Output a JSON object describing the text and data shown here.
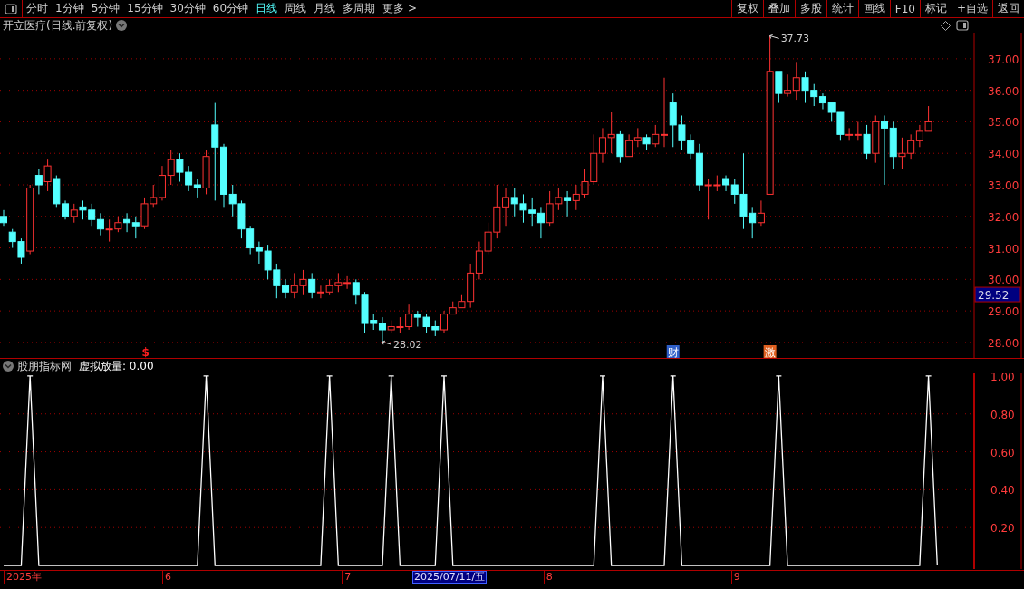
{
  "toolbar": {
    "tabs": [
      {
        "label": "分时",
        "selected": false
      },
      {
        "label": "1分钟",
        "selected": false
      },
      {
        "label": "5分钟",
        "selected": false
      },
      {
        "label": "15分钟",
        "selected": false
      },
      {
        "label": "30分钟",
        "selected": false
      },
      {
        "label": "60分钟",
        "selected": false
      },
      {
        "label": "日线",
        "selected": true
      },
      {
        "label": "周线",
        "selected": false
      },
      {
        "label": "月线",
        "selected": false
      },
      {
        "label": "多周期",
        "selected": false
      },
      {
        "label": "更多 >",
        "selected": false
      }
    ],
    "buttons": [
      "复权",
      "叠加",
      "多股",
      "统计",
      "画线",
      "F10",
      "标记",
      "+自选",
      "返回"
    ]
  },
  "main": {
    "title": "开立医疗(日线.前复权)",
    "chart_data": {
      "type": "candlestick",
      "grid": true,
      "ylim": [
        27.48,
        37.83
      ],
      "yticks": [
        {
          "value": 37,
          "label": "37.00"
        },
        {
          "value": 36,
          "label": "36.00"
        },
        {
          "value": 35,
          "label": "35.00"
        },
        {
          "value": 34,
          "label": "34.00"
        },
        {
          "value": 33,
          "label": "33.00"
        },
        {
          "value": 32,
          "label": "32.00"
        },
        {
          "value": 31,
          "label": "31.00"
        },
        {
          "value": 30,
          "label": "30.00"
        },
        {
          "value": 29,
          "label": "29.00"
        },
        {
          "value": 28,
          "label": "28.00"
        }
      ],
      "ohlc": [
        [
          32.0,
          32.2,
          31.7,
          31.8
        ],
        [
          31.5,
          31.6,
          31.0,
          31.2
        ],
        [
          31.2,
          31.3,
          30.5,
          30.7
        ],
        [
          30.9,
          33.0,
          30.8,
          32.9
        ],
        [
          33.3,
          33.5,
          32.7,
          33.0
        ],
        [
          33.1,
          33.8,
          32.8,
          33.6
        ],
        [
          33.2,
          33.3,
          32.3,
          32.4
        ],
        [
          32.4,
          32.5,
          31.9,
          32.0
        ],
        [
          32.0,
          32.4,
          31.8,
          32.2
        ],
        [
          32.3,
          32.5,
          31.9,
          32.2
        ],
        [
          32.2,
          32.4,
          31.7,
          31.9
        ],
        [
          31.9,
          32.1,
          31.4,
          31.6
        ],
        [
          31.6,
          31.9,
          31.2,
          31.6
        ],
        [
          31.6,
          32.0,
          31.5,
          31.8
        ],
        [
          31.9,
          32.1,
          31.5,
          31.8
        ],
        [
          31.8,
          32.0,
          31.3,
          31.7
        ],
        [
          31.7,
          32.6,
          31.6,
          32.4
        ],
        [
          32.4,
          33.0,
          32.3,
          32.6
        ],
        [
          32.6,
          33.6,
          32.5,
          33.3
        ],
        [
          33.3,
          34.1,
          33.0,
          33.8
        ],
        [
          33.8,
          34.0,
          33.1,
          33.4
        ],
        [
          33.4,
          33.6,
          32.8,
          33.0
        ],
        [
          33.0,
          33.2,
          32.6,
          32.9
        ],
        [
          32.9,
          34.1,
          32.7,
          33.9
        ],
        [
          34.9,
          35.6,
          32.5,
          34.2
        ],
        [
          34.2,
          34.3,
          32.3,
          32.7
        ],
        [
          32.7,
          33.0,
          32.0,
          32.4
        ],
        [
          32.4,
          32.5,
          31.3,
          31.6
        ],
        [
          31.6,
          31.7,
          30.8,
          31.0
        ],
        [
          31.0,
          31.2,
          30.5,
          30.9
        ],
        [
          30.9,
          31.1,
          30.0,
          30.3
        ],
        [
          30.3,
          30.5,
          29.4,
          29.8
        ],
        [
          29.8,
          30.0,
          29.4,
          29.6
        ],
        [
          29.6,
          30.2,
          29.4,
          29.8
        ],
        [
          29.8,
          30.3,
          29.5,
          30.0
        ],
        [
          30.0,
          30.2,
          29.4,
          29.6
        ],
        [
          29.6,
          29.8,
          29.4,
          29.6
        ],
        [
          29.6,
          30.0,
          29.5,
          29.8
        ],
        [
          29.8,
          30.2,
          29.6,
          29.9
        ],
        [
          29.9,
          30.1,
          29.7,
          29.9
        ],
        [
          29.9,
          30.0,
          29.2,
          29.5
        ],
        [
          29.5,
          29.6,
          28.3,
          28.6
        ],
        [
          28.7,
          28.9,
          28.4,
          28.6
        ],
        [
          28.6,
          28.8,
          28.02,
          28.4
        ],
        [
          28.4,
          28.7,
          28.3,
          28.5
        ],
        [
          28.5,
          28.8,
          28.3,
          28.5
        ],
        [
          28.5,
          29.2,
          28.4,
          28.9
        ],
        [
          28.9,
          29.0,
          28.5,
          28.8
        ],
        [
          28.8,
          28.9,
          28.3,
          28.5
        ],
        [
          28.5,
          28.7,
          28.2,
          28.4
        ],
        [
          28.4,
          29.0,
          28.3,
          28.9
        ],
        [
          28.9,
          29.3,
          28.9,
          29.1
        ],
        [
          29.1,
          29.5,
          29.1,
          29.3
        ],
        [
          29.3,
          30.5,
          29.1,
          30.2
        ],
        [
          30.2,
          31.2,
          30.0,
          30.9
        ],
        [
          30.9,
          31.8,
          30.8,
          31.5
        ],
        [
          31.5,
          33.0,
          31.3,
          32.3
        ],
        [
          32.3,
          32.9,
          31.7,
          32.6
        ],
        [
          32.6,
          32.9,
          32.0,
          32.4
        ],
        [
          32.4,
          32.7,
          31.8,
          32.2
        ],
        [
          32.2,
          32.6,
          31.7,
          32.1
        ],
        [
          32.1,
          32.3,
          31.3,
          31.8
        ],
        [
          31.8,
          32.8,
          31.7,
          32.4
        ],
        [
          32.4,
          32.9,
          32.2,
          32.6
        ],
        [
          32.6,
          32.8,
          32.0,
          32.5
        ],
        [
          32.5,
          33.0,
          32.2,
          32.7
        ],
        [
          32.7,
          33.5,
          32.6,
          33.1
        ],
        [
          33.1,
          34.6,
          33.0,
          34.0
        ],
        [
          34.0,
          34.8,
          33.7,
          34.5
        ],
        [
          34.5,
          35.3,
          34.0,
          34.6
        ],
        [
          34.6,
          34.7,
          33.7,
          33.9
        ],
        [
          33.9,
          34.6,
          33.9,
          34.4
        ],
        [
          34.4,
          34.8,
          34.2,
          34.5
        ],
        [
          34.5,
          34.6,
          34.1,
          34.3
        ],
        [
          34.3,
          34.9,
          34.2,
          34.6
        ],
        [
          34.6,
          36.4,
          34.2,
          34.6
        ],
        [
          35.6,
          35.9,
          34.2,
          34.9
        ],
        [
          34.9,
          35.2,
          34.1,
          34.4
        ],
        [
          34.4,
          34.6,
          33.8,
          34.0
        ],
        [
          34.0,
          34.3,
          32.8,
          33.0
        ],
        [
          33.0,
          33.2,
          31.9,
          33.0
        ],
        [
          33.0,
          33.3,
          32.8,
          33.0
        ],
        [
          33.2,
          33.3,
          32.8,
          33.0
        ],
        [
          33.0,
          33.2,
          32.4,
          32.7
        ],
        [
          32.7,
          34.0,
          31.6,
          32.0
        ],
        [
          32.1,
          32.3,
          31.3,
          31.8
        ],
        [
          31.8,
          32.5,
          31.7,
          32.1
        ],
        [
          32.7,
          37.73,
          32.7,
          36.6
        ],
        [
          36.6,
          36.6,
          35.6,
          35.9
        ],
        [
          35.9,
          36.5,
          35.8,
          36.0
        ],
        [
          36.0,
          36.9,
          35.7,
          36.4
        ],
        [
          36.4,
          36.6,
          35.6,
          36.0
        ],
        [
          36.0,
          36.2,
          35.5,
          35.8
        ],
        [
          35.8,
          35.9,
          35.4,
          35.6
        ],
        [
          35.6,
          35.6,
          35.0,
          35.3
        ],
        [
          35.3,
          35.3,
          34.4,
          34.6
        ],
        [
          34.6,
          34.8,
          34.4,
          34.6
        ],
        [
          34.6,
          35.0,
          34.4,
          34.6
        ],
        [
          34.6,
          34.9,
          33.8,
          34.0
        ],
        [
          34.0,
          35.2,
          33.7,
          35.0
        ],
        [
          35.0,
          35.2,
          33.0,
          34.8
        ],
        [
          34.8,
          35.0,
          33.5,
          33.9
        ],
        [
          33.9,
          34.5,
          33.5,
          34.0
        ],
        [
          34.0,
          34.6,
          33.8,
          34.4
        ],
        [
          34.4,
          34.9,
          34.2,
          34.7
        ],
        [
          34.7,
          35.5,
          34.7,
          35.0
        ]
      ],
      "annotations": [
        "37.73",
        "28.02"
      ]
    },
    "price_tag": "29.52",
    "date_axis": [
      "2025年",
      "6",
      "7",
      "8",
      "9"
    ],
    "events": [
      {
        "kind": "symbol",
        "label": "$",
        "color": "#ff2020"
      },
      {
        "kind": "badge",
        "label": "财",
        "color": "#2f5fc8"
      },
      {
        "kind": "badge",
        "label": "激",
        "color": "#e06020"
      }
    ],
    "cursor_date": "2025/07/11/五"
  },
  "indicator": {
    "name": "股朋指标网",
    "reading": "虚拟放量: 0.00",
    "chart_data": {
      "type": "line",
      "grid": true,
      "ylim": [
        -0.019,
        1.014
      ],
      "yticks": [
        {
          "value": 1,
          "label": "1.00"
        },
        {
          "value": 0.8,
          "label": "0.80"
        },
        {
          "value": 0.6,
          "label": "0.60"
        },
        {
          "value": 0.4,
          "label": "0.40"
        },
        {
          "value": 0.2,
          "label": "0.20"
        }
      ],
      "series": [
        {
          "color": "#ffffff",
          "values": [
            0,
            0,
            0,
            1,
            0,
            0,
            0,
            0,
            0,
            0,
            0,
            0,
            0,
            0,
            0,
            0,
            0,
            0,
            0,
            0,
            0,
            0,
            0,
            1,
            0,
            0,
            0,
            0,
            0,
            0,
            0,
            0,
            0,
            0,
            0,
            0,
            0,
            1,
            0,
            0,
            0,
            0,
            0,
            0,
            1,
            0,
            0,
            0,
            0,
            0,
            1,
            0,
            0,
            0,
            0,
            0,
            0,
            0,
            0,
            0,
            0,
            0,
            0,
            0,
            0,
            0,
            0,
            0,
            1,
            0,
            0,
            0,
            0,
            0,
            0,
            0,
            1,
            0,
            0,
            0,
            0,
            0,
            0,
            0,
            0,
            0,
            0,
            0,
            1,
            0,
            0,
            0,
            0,
            0,
            0,
            0,
            0,
            0,
            0,
            0,
            0,
            0,
            0,
            0,
            0,
            1,
            0
          ]
        }
      ]
    }
  }
}
